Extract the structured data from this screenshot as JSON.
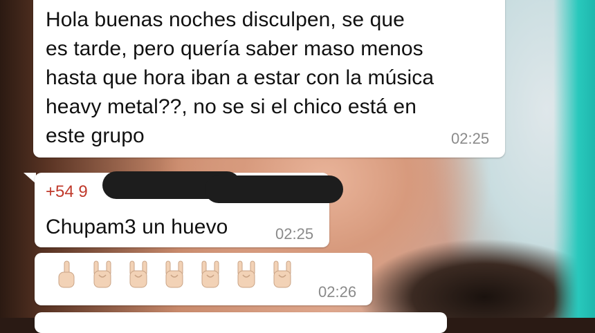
{
  "messages": [
    {
      "text": "Hola buenas noches disculpen, se que\nes tarde, pero quería saber maso menos\nhasta que hora iban a estar con  la música\nheavy metal??, no se si el chico está en\neste grupo",
      "time": "02:25"
    },
    {
      "sender": "+54 9",
      "text": "Chupam3 un huevo",
      "time": "02:25"
    },
    {
      "emojis": [
        "middle-finger-icon",
        "rock-hand-icon",
        "rock-hand-icon",
        "rock-hand-icon",
        "rock-hand-icon",
        "rock-hand-icon",
        "rock-hand-icon"
      ],
      "time": "02:26"
    }
  ],
  "colors": {
    "bubble": "#ffffff",
    "sender": "#c0392b",
    "time": "#8a8a8a",
    "redaction": "#1d1d1d"
  }
}
